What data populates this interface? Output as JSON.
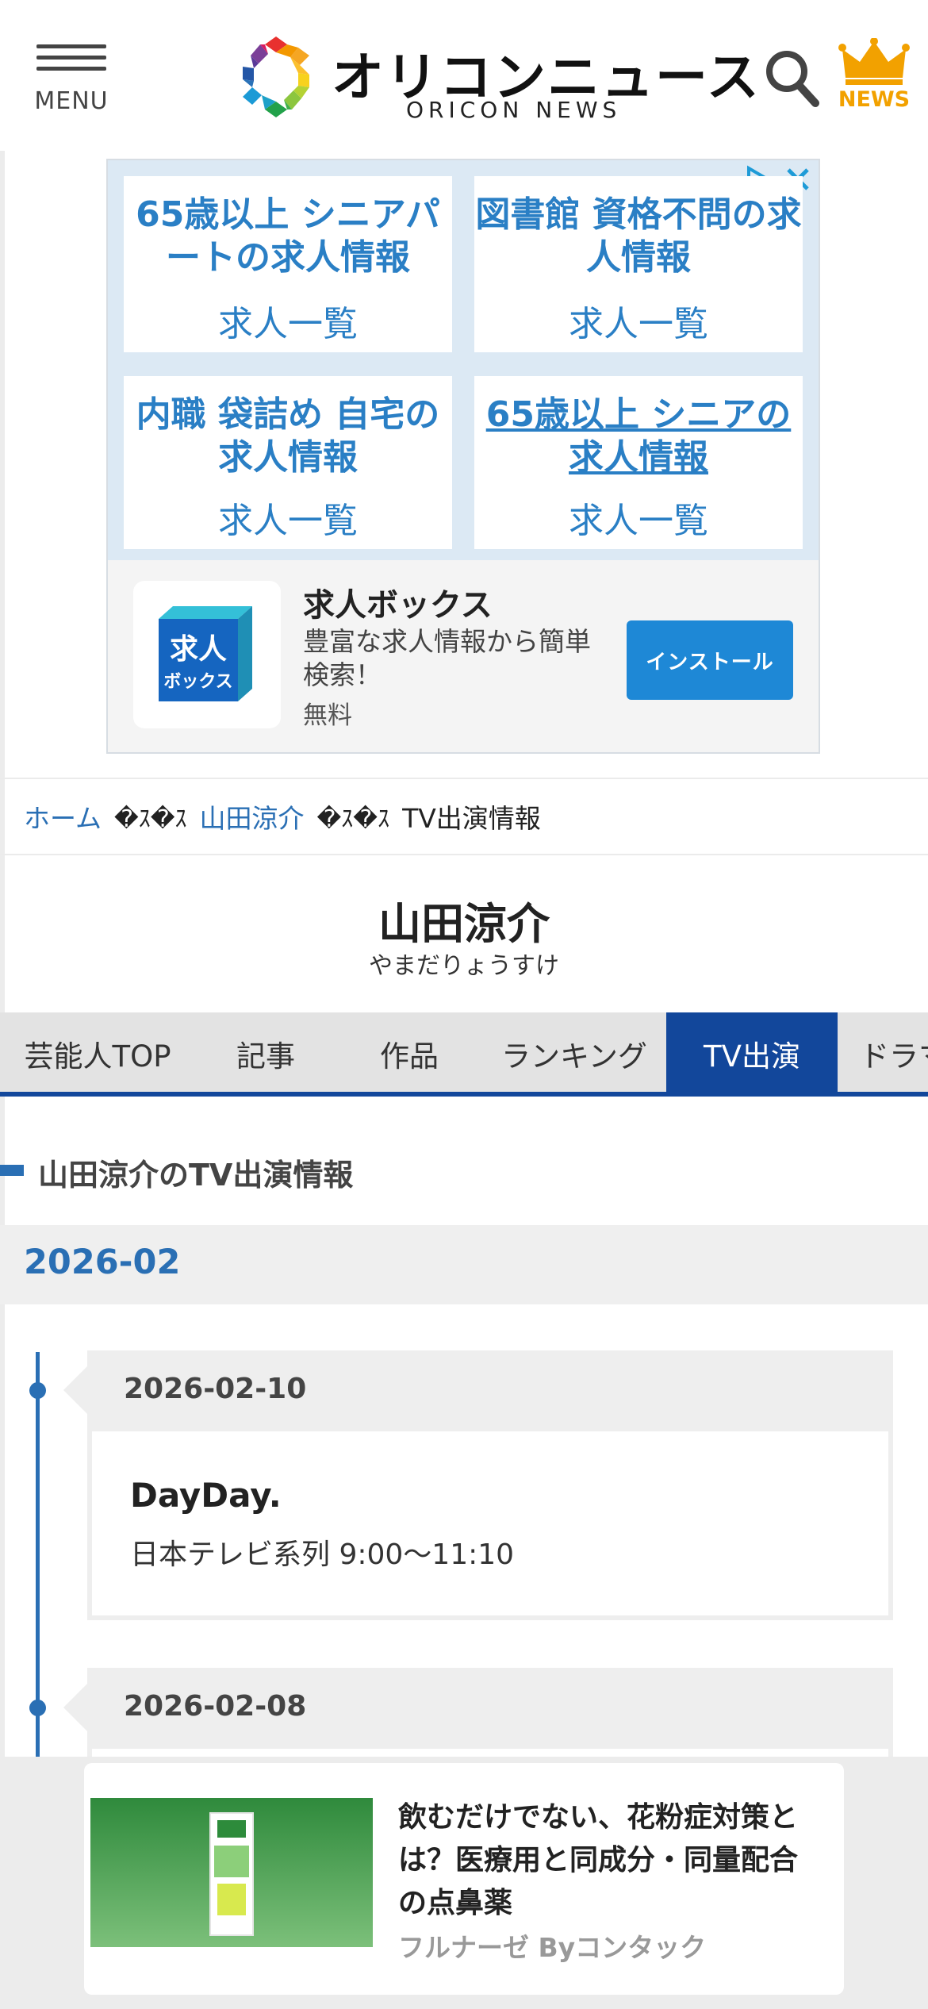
{
  "header": {
    "menu_label": "MENU",
    "logo_text": "オリコンニュース",
    "logo_subtext": "ORICON NEWS",
    "news_label": "NEWS",
    "news_color": "#f2a100"
  },
  "ad": {
    "tiles": [
      {
        "title": "65歳以上 シニアパートの求人情報",
        "link": "求人一覧"
      },
      {
        "title": "図書館 資格不問の求人情報",
        "link": "求人一覧"
      },
      {
        "title": "内職 袋詰め 自宅の求人情報",
        "link": "求人一覧"
      },
      {
        "title": "65歳以上 シニアの求人情報",
        "link": "求人一覧"
      }
    ],
    "app": {
      "icon_text_1": "求人",
      "icon_text_2": "ボックス",
      "name": "求人ボックス",
      "description": "豊富な求人情報から簡単検索！",
      "price": "無料",
      "install_label": "インストール"
    }
  },
  "breadcrumb": {
    "home": "ホーム",
    "separator": "�ｽ�ｽ",
    "artist": "山田涼介",
    "current": "TV出演情報"
  },
  "artist": {
    "name": "山田涼介",
    "kana": "やまだりょうすけ"
  },
  "tabs": [
    {
      "label": "芸能人TOP"
    },
    {
      "label": "記事"
    },
    {
      "label": "作品"
    },
    {
      "label": "ランキング"
    },
    {
      "label": "TV出演",
      "active": true
    },
    {
      "label": "ドラマ"
    }
  ],
  "section": {
    "title": "山田涼介のTV出演情報",
    "month": "2026-02"
  },
  "entries": [
    {
      "date": "2026-02-10",
      "program": "DayDay.",
      "info": "日本テレビ系列 9:00〜11:10"
    },
    {
      "date": "2026-02-08"
    }
  ],
  "sticky_ad": {
    "headline": "飲むだけでない、花粉症対策とは？医療用と同成分・同量配合の点鼻薬",
    "sponsor": "フルナーゼ Byコンタック"
  },
  "colors": {
    "brand_blue": "#12479b",
    "link_blue": "#2a6fb4",
    "ad_blue": "#2a7fc5",
    "install_blue": "#1e88d6"
  }
}
